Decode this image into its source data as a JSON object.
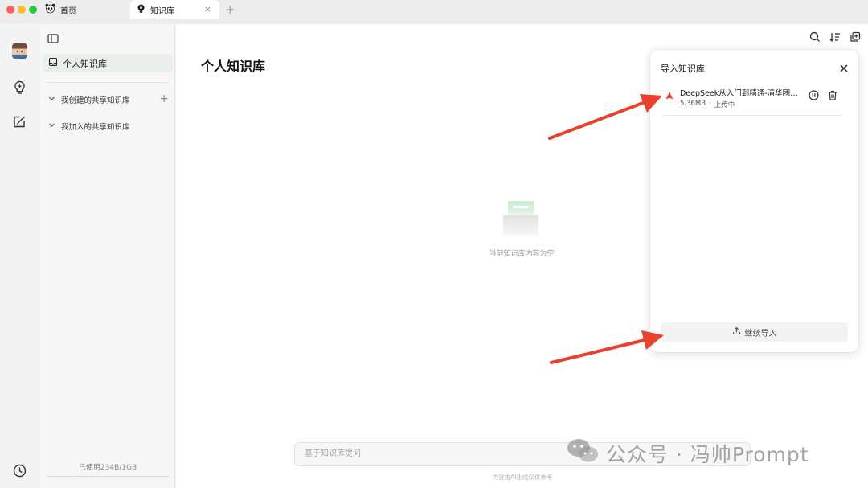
{
  "window": {
    "tabs": [
      {
        "label": "首页",
        "icon": "panda-icon"
      },
      {
        "label": "知识库",
        "icon": "lightbulb-icon",
        "close": "×"
      }
    ],
    "new_tab": "+"
  },
  "sidebar": {
    "personal_label": "个人知识库",
    "created_shared_label": "我创建的共享知识库",
    "joined_shared_label": "我加入的共享知识库",
    "add_symbol": "+",
    "usage_text": "已使用234B/1GB"
  },
  "main": {
    "title": "个人知识库",
    "empty_text": "当前知识库内容为空",
    "ask_placeholder": "基于知识库提问",
    "disclaimer": "内容由AI生成仅供参考"
  },
  "import_panel": {
    "title": "导入知识库",
    "file": {
      "name": "DeepSeek从入门到精通-清华团队....",
      "size": "5.36MB",
      "separator": "·",
      "status": "上传中"
    },
    "continue_label": "继续导入"
  },
  "watermark": {
    "text": "公众号 · 冯帅Prompt"
  },
  "colors": {
    "accent_green": "#e9efe9",
    "arrow_red": "#e8412d",
    "file_icon_red": "#e8412d"
  }
}
